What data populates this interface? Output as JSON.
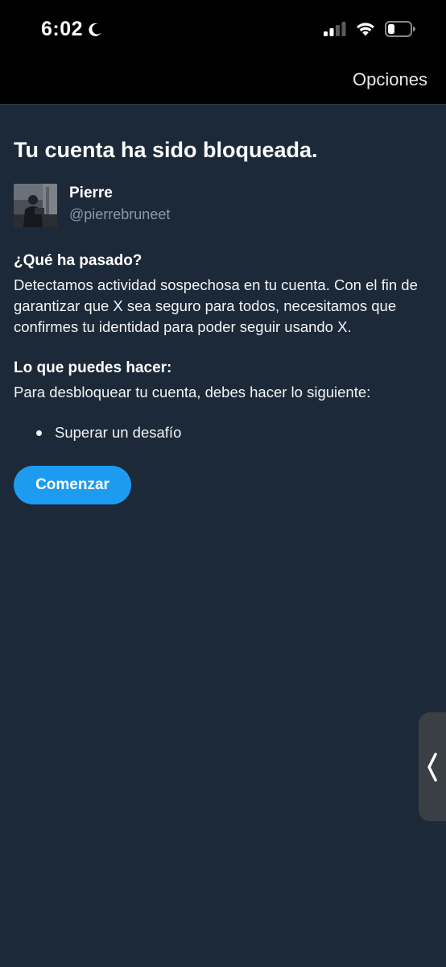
{
  "status_bar": {
    "time": "6:02",
    "icons": [
      "moon-icon",
      "signal-icon",
      "wifi-icon",
      "battery-icon"
    ]
  },
  "nav": {
    "options_label": "Opciones"
  },
  "page": {
    "title": "Tu cuenta ha sido bloqueada."
  },
  "account": {
    "name": "Pierre",
    "handle": "@pierrebruneet"
  },
  "what_happened": {
    "heading": "¿Qué ha pasado?",
    "body": "Detectamos actividad sospechosa en tu cuenta. Con el fin de garantizar que X sea seguro para todos, necesitamos que confirmes tu identidad para poder seguir usando X."
  },
  "what_to_do": {
    "heading": "Lo que puedes hacer:",
    "body": "Para desbloquear tu cuenta, debes hacer lo siguiente:",
    "steps": [
      "Superar un desafío"
    ]
  },
  "actions": {
    "start_label": "Comenzar"
  },
  "colors": {
    "background": "#1c2938",
    "accent": "#1d9bf0",
    "secondary_text": "#8b98a5"
  }
}
